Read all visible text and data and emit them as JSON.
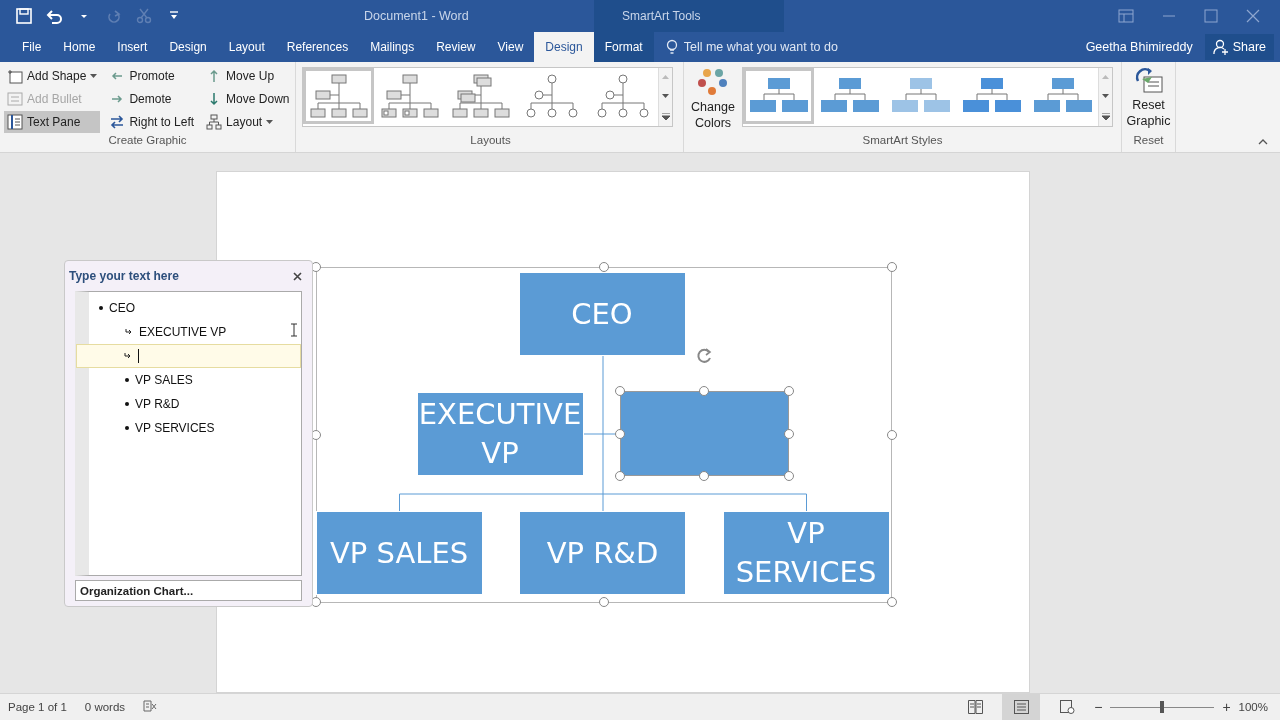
{
  "window": {
    "title": "Document1 - Word",
    "context_title": "SmartArt Tools"
  },
  "quick_access": [
    {
      "kind": "save",
      "disabled": false
    },
    {
      "kind": "undo",
      "disabled": false
    },
    {
      "kind": "dropdown",
      "disabled": false
    },
    {
      "kind": "redo",
      "disabled": true
    },
    {
      "kind": "cut",
      "disabled": true
    },
    {
      "kind": "customize",
      "disabled": false
    }
  ],
  "tabs": [
    {
      "label": "File",
      "selected": false,
      "contextual": false
    },
    {
      "label": "Home",
      "selected": false,
      "contextual": false
    },
    {
      "label": "Insert",
      "selected": false,
      "contextual": false
    },
    {
      "label": "Design",
      "selected": false,
      "contextual": false
    },
    {
      "label": "Layout",
      "selected": false,
      "contextual": false
    },
    {
      "label": "References",
      "selected": false,
      "contextual": false
    },
    {
      "label": "Mailings",
      "selected": false,
      "contextual": false
    },
    {
      "label": "Review",
      "selected": false,
      "contextual": false
    },
    {
      "label": "View",
      "selected": false,
      "contextual": false
    },
    {
      "label": "Design",
      "selected": true,
      "contextual": true
    },
    {
      "label": "Format",
      "selected": false,
      "contextual": true
    }
  ],
  "tell_me": {
    "placeholder": "Tell me what you want to do"
  },
  "user": "Geetha Bhimireddy",
  "share": "Share",
  "create_graphic": {
    "label": "Create Graphic",
    "commands": [
      {
        "kind": "add-shape",
        "label": "Add Shape",
        "disabled": false,
        "selected": false,
        "dropdown": true
      },
      {
        "kind": "add-bullet",
        "label": "Add Bullet",
        "disabled": true,
        "selected": false,
        "dropdown": false
      },
      {
        "kind": "text-pane",
        "label": "Text Pane",
        "disabled": false,
        "selected": true,
        "dropdown": false
      },
      {
        "kind": "promote",
        "label": "Promote",
        "disabled": false,
        "selected": false,
        "dropdown": false
      },
      {
        "kind": "demote",
        "label": "Demote",
        "disabled": false,
        "selected": false,
        "dropdown": false
      },
      {
        "kind": "right-to-left",
        "label": "Right to Left",
        "disabled": false,
        "selected": false,
        "dropdown": false
      },
      {
        "kind": "move-up",
        "label": "Move Up",
        "disabled": false,
        "selected": false,
        "dropdown": false
      },
      {
        "kind": "move-down",
        "label": "Move Down",
        "disabled": false,
        "selected": false,
        "dropdown": false
      },
      {
        "kind": "layout",
        "label": "Layout",
        "disabled": false,
        "selected": false,
        "dropdown": true
      }
    ]
  },
  "layouts": {
    "label": "Layouts",
    "items": [
      {
        "kind": "boxes",
        "selected": true
      },
      {
        "kind": "picture-boxes",
        "selected": false
      },
      {
        "kind": "stacked",
        "selected": false
      },
      {
        "kind": "circles",
        "selected": false
      },
      {
        "kind": "circle-tree",
        "selected": false
      }
    ]
  },
  "change_colors": {
    "label": "Change Colors"
  },
  "styles": {
    "label": "SmartArt Styles",
    "items": [
      {
        "color": "#5b9bd5",
        "selected": true
      },
      {
        "color": "#5b9bd5",
        "selected": false
      },
      {
        "color": "#9dc3e6",
        "selected": false
      },
      {
        "color": "#4a90d9",
        "selected": false
      },
      {
        "color": "#5b9bd5",
        "selected": false
      }
    ]
  },
  "reset": {
    "label": "Reset",
    "button": "Reset Graphic"
  },
  "text_pane": {
    "title": "Type your text here",
    "items": [
      {
        "text": "CEO",
        "kind": "bullet",
        "active": false,
        "children": [
          {
            "text": "EXECUTIVE VP",
            "kind": "assistant",
            "active": false
          },
          {
            "kind": "assistant",
            "active": true
          },
          {
            "text": "VP SALES",
            "kind": "bullet",
            "active": false
          },
          {
            "text": "VP R&D",
            "kind": "bullet",
            "active": false
          },
          {
            "text": "VP SERVICES",
            "kind": "bullet",
            "active": false
          }
        ]
      }
    ],
    "footer": "Organization Chart..."
  },
  "diagram": {
    "nodes": [
      {
        "text": "CEO",
        "kind": "manager",
        "selected": false
      },
      {
        "text": "EXECUTIVE VP",
        "kind": "assistant",
        "selected": false
      },
      {
        "kind": "assistant",
        "selected": true
      },
      {
        "text": "VP SALES",
        "kind": "staff",
        "selected": false
      },
      {
        "text": "VP R&D",
        "kind": "staff",
        "selected": false
      },
      {
        "text": "VP SERVICES",
        "kind": "staff",
        "selected": false
      }
    ]
  },
  "status_bar": {
    "page": "Page 1 of 1",
    "words": "0 words",
    "views": [
      {
        "kind": "read",
        "selected": false
      },
      {
        "kind": "print",
        "selected": true
      },
      {
        "kind": "web",
        "selected": false
      }
    ],
    "zoom": {
      "level": 0.5,
      "reading": "100%",
      "zoom_out": "−",
      "zoom_in": "+"
    }
  }
}
